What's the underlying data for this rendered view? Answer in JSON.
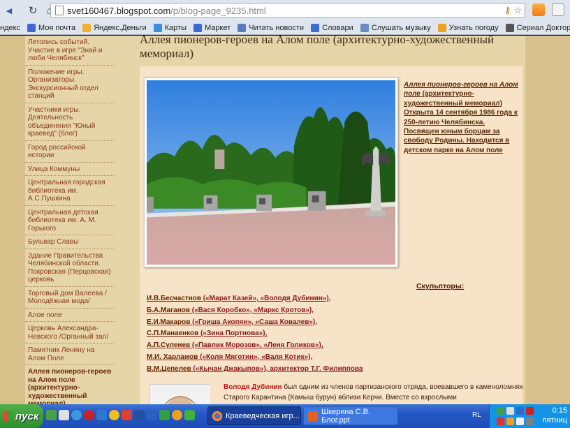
{
  "browser": {
    "url_domain": "svet160467.blogspot.com",
    "url_path": "/p/blog-page_9235.html",
    "nav": {
      "back": "◀",
      "reload": "↻",
      "home": "⌂"
    },
    "bookmarks": [
      {
        "label": "ндекс",
        "color": "#e23a2a"
      },
      {
        "label": "Моя почта",
        "color": "#3b6ad6"
      },
      {
        "label": "Яндекс.Деньги",
        "color": "#f0b030"
      },
      {
        "label": "Карты",
        "color": "#3b8de0"
      },
      {
        "label": "Маркет",
        "color": "#3b6ad6"
      },
      {
        "label": "Читать новости",
        "color": "#5a7ac0"
      },
      {
        "label": "Словари",
        "color": "#3b6ad6"
      },
      {
        "label": "Слушать музыку",
        "color": "#6a8ac8"
      },
      {
        "label": "Узнать погоду",
        "color": "#f0a020"
      },
      {
        "label": "Сериал Доктор Хаус…",
        "color": "#555555"
      }
    ]
  },
  "sidebar": {
    "items": [
      {
        "label": "Летопись событий. Участие в игре \"Знай и люби Челябинск\""
      },
      {
        "label": "Положение игры. Организаторы. Экскурсионный отдел станций"
      },
      {
        "label": "Участники игры. Деятельность объединения \"Юный краевед\" (блог)"
      },
      {
        "label": "Город российской истории"
      },
      {
        "label": "Улица Коммуны"
      },
      {
        "label": "Центральная городская библиотека им. А.С.Пушкина"
      },
      {
        "label": "Центральная детская библиотека им. А. М. Горького"
      },
      {
        "label": "Бульвар Славы"
      },
      {
        "label": "Здание Правительства Челябинской области. Покровская (Перцовская) церковь"
      },
      {
        "label": "Торговый дом Валеева / Молодёжная мода/"
      },
      {
        "label": "Алое поле"
      },
      {
        "label": "Церковь Александра-Невского /Органный зал/"
      },
      {
        "label": "Памятник Ленину на Алом Поле"
      },
      {
        "label": "Аллея пионеров-героев на Алом поле (архитектурно-художественный мемориал)"
      }
    ]
  },
  "post": {
    "title": "Аллея пионеров-героев на Алом поле (архитектурно-художественный мемориал)",
    "caption": {
      "title_part": "Аллея пионеров-героев на Алом поле",
      "title_rest": " (архитектурно-художественный мемориал)",
      "line2": "Открыта 14 сентября 1986 года к 250-летию Челябинска.",
      "line3": "Посвящен юным борцам за свободу Родины. Находится в детском парке на Алом поле"
    },
    "sculptors_title": "Скульпторы:",
    "sculptors": [
      {
        "name": "И.В.Бесчастнов",
        "works": " («Марат Казей», «Володя Дубинин»),"
      },
      {
        "name": "Б.А.Маганов",
        "works": " («Вася Коробко», «Маркс Кротов»),"
      },
      {
        "name": "Е.И.Макаров",
        "works": " («Гриша Акопян», «Саша Ковалев»),"
      },
      {
        "name": "С.П.Манаенков",
        "works": " («Зина Портнова»),"
      },
      {
        "name": "А.П.Суленев",
        "works": " («Павлик Морозов», «Леня Голиков»),"
      },
      {
        "name": "М.И. Харламов",
        "works": " («Коля Мяготин», «Валя Котик»),"
      },
      {
        "name": "В.М.Цепелев",
        "works": " («Кычан Джакыпов»), архитектор Т.Г. Филиппова"
      }
    ],
    "story_name": "Володя Дубинин",
    "story_text": " был одним из членов партизанского отряда, воевавшего в каменоломнях Старого Карантина (Камыш бурун) вблизи Керчи. Вместе со взрослыми"
  },
  "taskbar": {
    "start_label": "пуск",
    "tasks": [
      {
        "label": "Краеведческая игр..."
      },
      {
        "label": "Шкерина С.В. Блог.ppt"
      }
    ],
    "lang": "RL",
    "time": "0:15",
    "day": "пятниц"
  },
  "colors": {
    "page_bg": "#e6d5a8",
    "content_bg": "#f7e4c8",
    "link": "#8a3a1a",
    "taskbar": "#2457c4",
    "start": "#2f8f2c"
  }
}
